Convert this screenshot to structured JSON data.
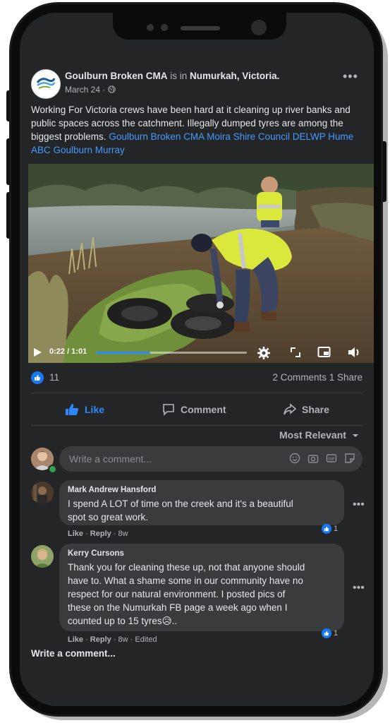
{
  "post": {
    "page_name": "Goulburn Broken CMA",
    "is_in": "is in",
    "location": "Numurkah, Victoria.",
    "date": "March 24 ·",
    "text": "Working For Victoria crews have been hard at it cleaning up river banks and public spaces across the catchment. Illegally dumped tyres are among the biggest problems.",
    "tags": "Goulburn Broken CMA Moira Shire Council DELWP Hume ABC Goulburn Murray",
    "more_icon": "more-horizontal-icon"
  },
  "video": {
    "time": "0:22 / 1:01",
    "progress": 0.36
  },
  "engagement": {
    "like_count": "11",
    "comments_shares": "2 Comments  1 Share"
  },
  "actions": {
    "like_label": "Like",
    "comment_label": "Comment",
    "share_label": "Share"
  },
  "sort_label": "Most Relevant",
  "write_comment_placeholder": "Write a comment...",
  "comments": [
    {
      "name": "Mark Andrew Hansford",
      "text_lines": [
        "I spend A LOT of time on the creek and it's a beautiful",
        "spot so great work."
      ],
      "like": "Like",
      "reply": "Reply",
      "meta": "· 8w",
      "reactions": "1"
    },
    {
      "name": "Kerry Cursons",
      "text_lines": [
        "Thank you for cleaning these up, not that anyone should",
        "have to. What a shame some in our community have no",
        "respect for our natural environment. I posted pics of",
        "these on the Numurkah FB page a week ago when I",
        "counted up to 15 tyres😥.."
      ],
      "like": "Like",
      "reply": "Reply",
      "meta": "· 8w · Edited",
      "reactions": "1"
    }
  ],
  "write_comment_bottom": "Write a comment...",
  "colors": {
    "background": "#242526",
    "link": "#4599ff",
    "like_blue": "#1877f2"
  }
}
